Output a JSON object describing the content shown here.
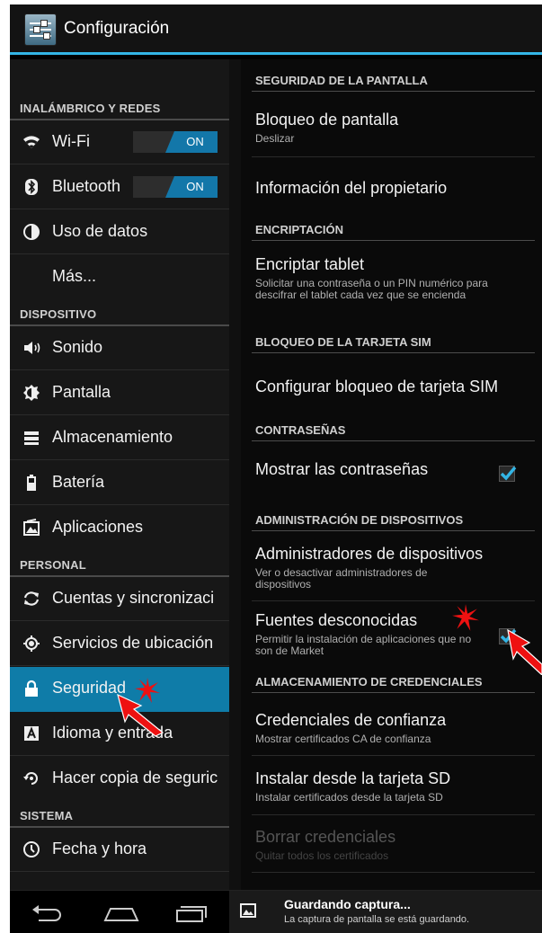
{
  "app": {
    "title": "Configuración",
    "icon": "settings-sliders-icon"
  },
  "sidebar": {
    "sections": [
      {
        "header": "INALÁMBRICO Y REDES"
      },
      {
        "header": "DISPOSITIVO"
      },
      {
        "header": "PERSONAL"
      },
      {
        "header": "SISTEMA"
      }
    ],
    "items": [
      {
        "label": "Wi-Fi",
        "icon": "wifi-icon",
        "toggle": "ON"
      },
      {
        "label": "Bluetooth",
        "icon": "bluetooth-icon",
        "toggle": "ON"
      },
      {
        "label": "Uso de datos",
        "icon": "data-usage-icon"
      },
      {
        "label": "Más..."
      },
      {
        "label": "Sonido",
        "icon": "speaker-icon"
      },
      {
        "label": "Pantalla",
        "icon": "brightness-icon"
      },
      {
        "label": "Almacenamiento",
        "icon": "storage-icon"
      },
      {
        "label": "Batería",
        "icon": "battery-icon"
      },
      {
        "label": "Aplicaciones",
        "icon": "apps-icon"
      },
      {
        "label": "Cuentas y sincronizaci",
        "icon": "sync-icon"
      },
      {
        "label": "Servicios de ubicación",
        "icon": "location-icon"
      },
      {
        "label": "Seguridad",
        "icon": "lock-icon",
        "selected": true
      },
      {
        "label": "Idioma y entrada",
        "icon": "keyboard-icon"
      },
      {
        "label": "Hacer copia de seguric",
        "icon": "backup-icon"
      },
      {
        "label": "Fecha y hora",
        "icon": "clock-icon"
      }
    ]
  },
  "detail": {
    "headers": {
      "screen_security": "SEGURIDAD DE LA PANTALLA",
      "encryption": "ENCRIPTACIÓN",
      "sim_lock": "BLOQUEO DE LA TARJETA SIM",
      "passwords": "CONTRASEÑAS",
      "device_admin": "ADMINISTRACIÓN DE DISPOSITIVOS",
      "credential_storage": "ALMACENAMIENTO DE CREDENCIALES"
    },
    "screen_lock": {
      "title": "Bloqueo de pantalla",
      "summary": "Deslizar"
    },
    "owner_info": {
      "title": "Información del propietario"
    },
    "encrypt": {
      "title": "Encriptar tablet",
      "summary": "Solicitar una contraseña o un PIN numérico para descifrar el tablet cada vez que se encienda"
    },
    "sim": {
      "title": "Configurar bloqueo de tarjeta SIM"
    },
    "show_passwords": {
      "title": "Mostrar las contraseñas",
      "checked": true
    },
    "device_admins": {
      "title": "Administradores de dispositivos",
      "summary": "Ver o desactivar administradores de dispositivos"
    },
    "unknown_sources": {
      "title": "Fuentes desconocidas",
      "summary": "Permitir la instalación de aplicaciones que no son de Market",
      "checked": true
    },
    "trusted_creds": {
      "title": "Credenciales de confianza",
      "summary": "Mostrar certificados CA de confianza"
    },
    "install_sd": {
      "title": "Instalar desde la tarjeta SD",
      "summary": "Instalar certificados desde la tarjeta SD"
    },
    "clear_creds": {
      "title": "Borrar credenciales",
      "summary": "Quitar todos los certificados",
      "enabled": false
    }
  },
  "notification": {
    "title": "Guardando captura...",
    "text": "La captura de pantalla se está guardando."
  },
  "nav": {
    "back": "back-icon",
    "home": "home-icon",
    "recents": "recents-icon"
  },
  "annotations": {
    "arrow_color": "#ee1111",
    "accent": "#33b5e5",
    "selected_bg": "#0f7ca8"
  }
}
